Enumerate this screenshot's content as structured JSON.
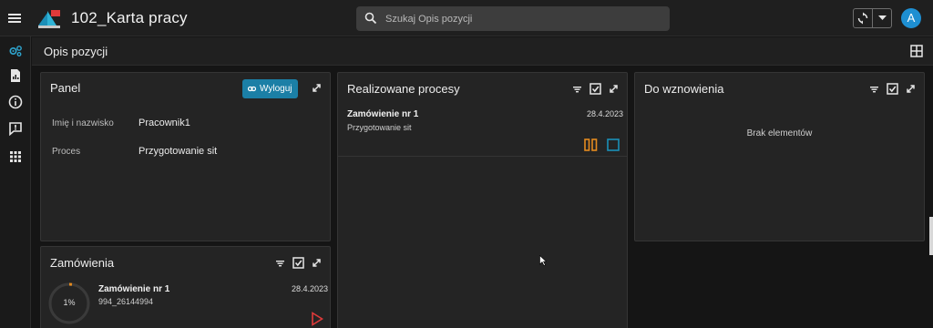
{
  "app": {
    "title": "102_Karta pracy",
    "avatar_initial": "A"
  },
  "search": {
    "placeholder": "Szukaj Opis pozycji"
  },
  "page": {
    "title": "Opis pozycji"
  },
  "panels": {
    "panel": {
      "title": "Panel",
      "logout_label": "Wyloguj",
      "fields": [
        {
          "label": "Imię i nazwisko",
          "value": "Pracownik1"
        },
        {
          "label": "Proces",
          "value": "Przygotowanie sit"
        }
      ]
    },
    "realizowane": {
      "title": "Realizowane procesy",
      "items": [
        {
          "title": "Zamówienie nr 1",
          "subtitle": "Przygotowanie sit",
          "date": "28.4.2023"
        }
      ]
    },
    "wznowienia": {
      "title": "Do wznowienia",
      "empty_message": "Brak elementów"
    },
    "zamowienia": {
      "title": "Zamówienia",
      "items": [
        {
          "title": "Zamówienie nr 1",
          "subtitle": "994_26144994",
          "date": "28.4.2023",
          "progress_label": "1%",
          "progress_value": 0.01
        }
      ]
    }
  },
  "colors": {
    "accent": "#1b7fa6",
    "avatar": "#1e8fd2",
    "pause": "#e58b1f",
    "stop": "#1b8fb8",
    "play": "#e03a3a",
    "progress": "#e58b1f"
  },
  "icons": {
    "rail": [
      "settings-icon",
      "document-icon",
      "info-icon",
      "feedback-icon",
      "apps-grid-icon"
    ]
  }
}
